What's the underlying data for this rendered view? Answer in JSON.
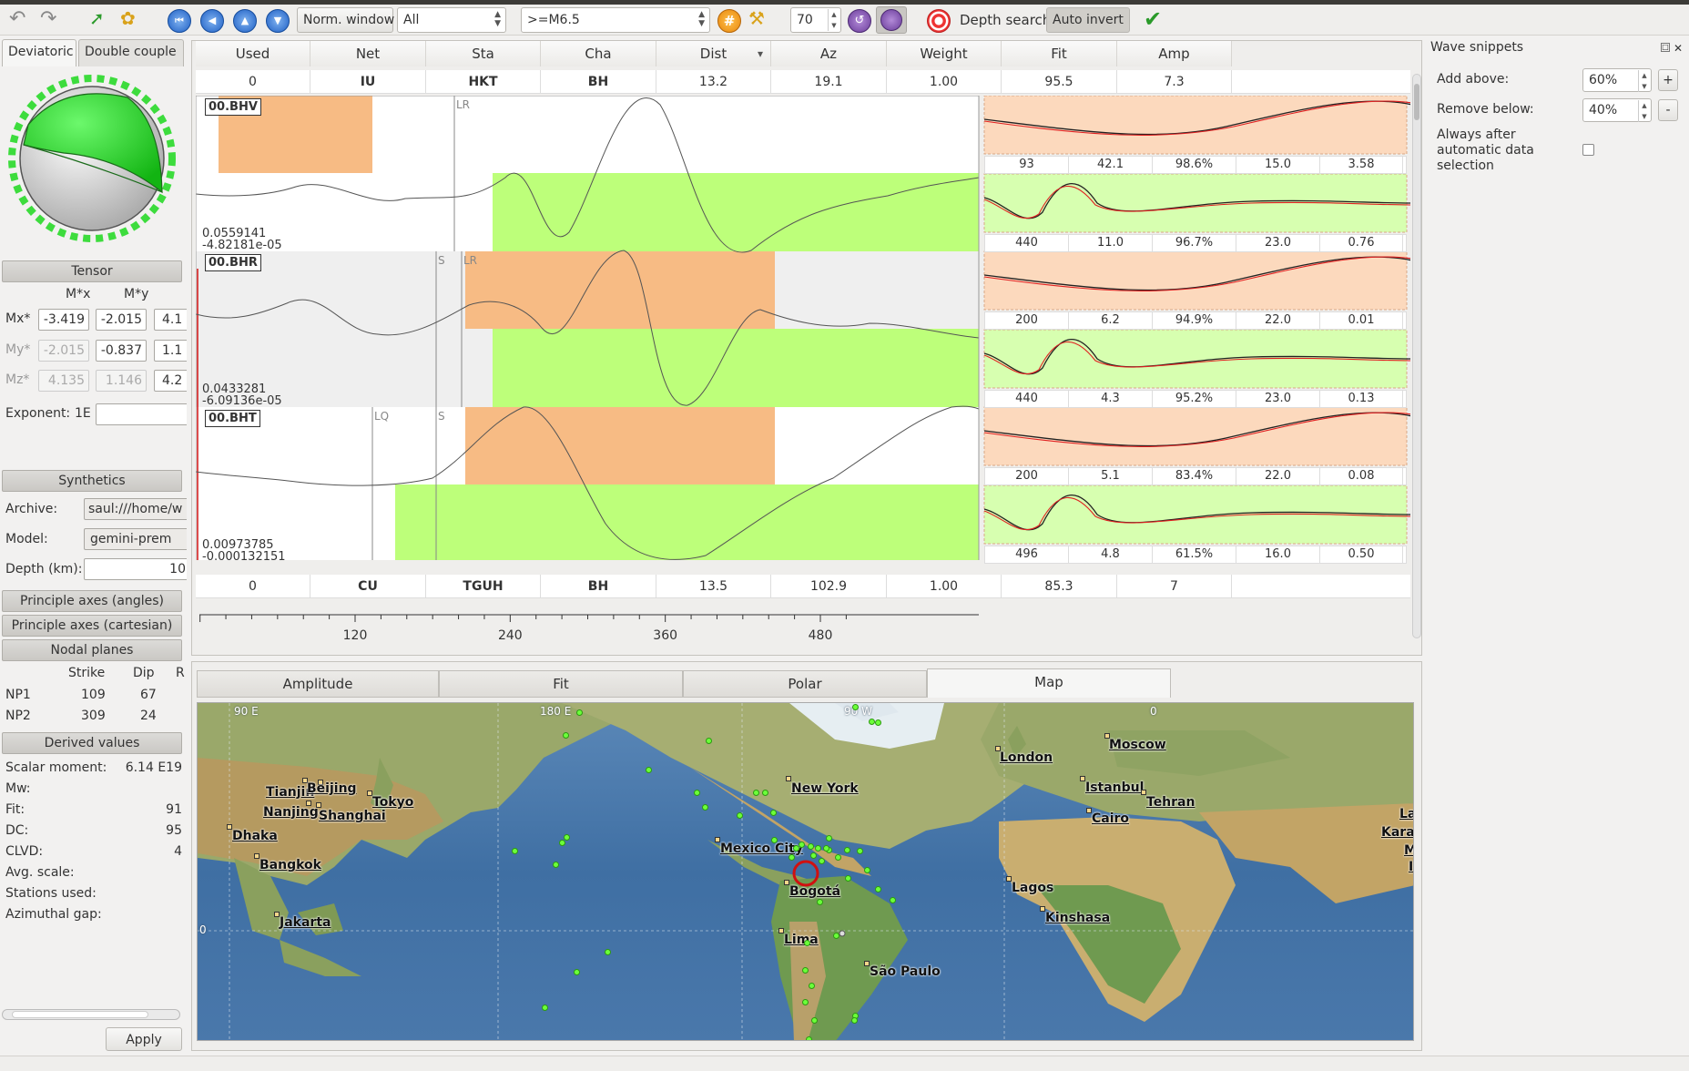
{
  "toolbar": {
    "norm_window": "Norm. window",
    "filter_combo": "All",
    "magnitude_combo": ">=M6.5",
    "spin_value": "70",
    "depth_search": "Depth search",
    "auto_invert": "Auto invert"
  },
  "left": {
    "tab_deviatoric": "Deviatoric",
    "tab_double_couple": "Double couple",
    "tensor_header": "Tensor",
    "col_mx": "M*x",
    "col_my": "M*y",
    "row_mx": "Mx*",
    "row_my": "My*",
    "row_mz": "Mz*",
    "mx": [
      "-3.419",
      "-2.015",
      "4.1"
    ],
    "my": [
      "-2.015",
      "-0.837",
      "1.1"
    ],
    "mz": [
      "4.135",
      "1.146",
      "4.2"
    ],
    "exponent_label": "Exponent:",
    "exponent_prefix": "1E",
    "exponent_value": "",
    "synthetics_header": "Synthetics",
    "archive_label": "Archive:",
    "archive_value": "saul:///home/w",
    "model_label": "Model:",
    "model_value": "gemini-prem",
    "depth_label": "Depth (km):",
    "depth_value": "10",
    "principle_angles": "Principle axes (angles)",
    "principle_cartesian": "Principle axes (cartesian)",
    "nodal_planes": "Nodal planes",
    "np_head_strike": "Strike",
    "np_head_dip": "Dip",
    "np_head_rake": "R",
    "np1": {
      "label": "NP1",
      "strike": "109",
      "dip": "67"
    },
    "np2": {
      "label": "NP2",
      "strike": "309",
      "dip": "24"
    },
    "derived_header": "Derived values",
    "scalar_moment_label": "Scalar moment:",
    "scalar_moment_value": "6.14 E19",
    "mw_label": "Mw:",
    "mw_value": "",
    "fit_label": "Fit:",
    "fit_value": "91",
    "dc_label": "DC:",
    "dc_value": "95",
    "clvd_label": "CLVD:",
    "clvd_value": "4",
    "avg_scale_label": "Avg. scale:",
    "stations_used_label": "Stations used:",
    "azimuthal_gap_label": "Azimuthal gap:",
    "apply": "Apply"
  },
  "columns": [
    "Used",
    "Net",
    "Sta",
    "Cha",
    "Dist",
    "Az",
    "Weight",
    "Fit",
    "Amp"
  ],
  "stations": [
    {
      "used": "0",
      "net": "IU",
      "sta": "HKT",
      "cha": "BH",
      "dist": "13.2",
      "az": "19.1",
      "weight": "1.00",
      "fit": "95.5",
      "amp": "7.3"
    },
    {
      "used": "0",
      "net": "CU",
      "sta": "TGUH",
      "cha": "BH",
      "dist": "13.5",
      "az": "102.9",
      "weight": "1.00",
      "fit": "85.3",
      "amp": "7"
    }
  ],
  "traces": [
    {
      "label": "00.BHV",
      "amp_top": "0.0559141",
      "amp_bot": "-4.82181e-05",
      "phases": [
        "LR"
      ]
    },
    {
      "label": "00.BHR",
      "amp_top": "0.0433281",
      "amp_bot": "-6.09136e-05",
      "phases": [
        "S",
        "LR"
      ]
    },
    {
      "label": "00.BHT",
      "amp_top": "0.00973785",
      "amp_bot": "-0.000132151",
      "phases": [
        "LQ",
        "S"
      ]
    }
  ],
  "snippet_rows": [
    [
      "93",
      "42.1",
      "98.6%",
      "15.0",
      "3.58"
    ],
    [
      "440",
      "11.0",
      "96.7%",
      "23.0",
      "0.76"
    ],
    [
      "200",
      "6.2",
      "94.9%",
      "22.0",
      "0.01"
    ],
    [
      "440",
      "4.3",
      "95.2%",
      "23.0",
      "0.13"
    ],
    [
      "200",
      "5.1",
      "83.4%",
      "22.0",
      "0.08"
    ],
    [
      "496",
      "4.8",
      "61.5%",
      "16.0",
      "0.50"
    ]
  ],
  "time_axis": [
    "120",
    "240",
    "360",
    "480"
  ],
  "bottom_tabs": [
    "Amplitude",
    "Fit",
    "Polar",
    "Map"
  ],
  "map": {
    "grid_labels": [
      "90 E",
      "180 E",
      "90 W",
      "0",
      "0"
    ],
    "cities": [
      "Tianjin",
      "Beijing",
      "Nanjing",
      "Shanghai",
      "Tokyo",
      "Dhaka",
      "Bangkok",
      "Jakarta",
      "New York",
      "Mexico City",
      "Bogotá",
      "Lima",
      "São Paulo",
      "London",
      "Moscow",
      "Istanbul",
      "Tehran",
      "Cairo",
      "Lagos",
      "Kinshasa",
      "La",
      "Karaci",
      "Mu",
      "I"
    ]
  },
  "right": {
    "title": "Wave snippets",
    "add_above_label": "Add above:",
    "add_above_value": "60%",
    "remove_below_label": "Remove below:",
    "remove_below_value": "40%",
    "always_after_label": "Always after automatic data selection",
    "plus": "+",
    "minus": "-"
  },
  "colors": {
    "orange_window": "#f7bb84",
    "green_window": "#bdff7a",
    "beachball_green": "#1fd41f",
    "marker_red": "#d01010"
  }
}
